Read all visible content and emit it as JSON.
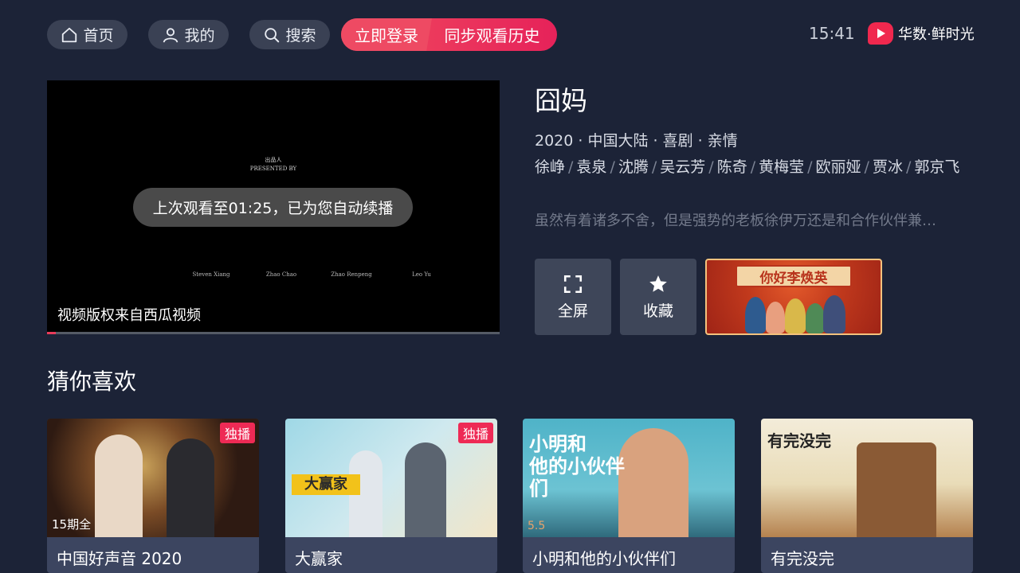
{
  "nav": {
    "home": "首页",
    "mine": "我的",
    "search": "搜索",
    "login": "立即登录",
    "sync": "同步观看历史"
  },
  "status": {
    "clock": "15:41"
  },
  "brand": {
    "name": "华数·鲜时光",
    "color": "#f0284e"
  },
  "player": {
    "credit_cn": "出品人",
    "credit_en": "PRESENTED BY",
    "resume_notice": "上次观看至01:25，已为您自动续播",
    "copyright": "视频版权来自西瓜视频",
    "progress": 0.02,
    "names": [
      "Steven Xiang",
      "Zhao Chao",
      "Zhao Renpeng",
      "Leo Yu"
    ]
  },
  "detail": {
    "title": "囧妈",
    "meta": "2020 · 中国大陆 · 喜剧 · 亲情",
    "cast": [
      "徐峥",
      "袁泉",
      "沈腾",
      "吴云芳",
      "陈奇",
      "黄梅莹",
      "欧丽娅",
      "贾冰",
      "郭京飞"
    ],
    "description": "虽然有着诸多不舍，但是强势的老板徐伊万还是和合作伙伴兼…",
    "actions": {
      "fullscreen": "全屏",
      "favorite": "收藏"
    },
    "promo_text": "你好李焕英"
  },
  "recommend": {
    "title": "猜你喜欢",
    "items": [
      {
        "title": "中国好声音 2020",
        "badge": "独播",
        "caption": "15期全",
        "score": ""
      },
      {
        "title": "大赢家",
        "badge": "独播",
        "caption": "",
        "score": ""
      },
      {
        "title": "小明和他的小伙伴们",
        "badge": "",
        "caption": "",
        "score": "5.5"
      },
      {
        "title": "有完没完",
        "badge": "",
        "caption": "",
        "score": ""
      }
    ]
  }
}
